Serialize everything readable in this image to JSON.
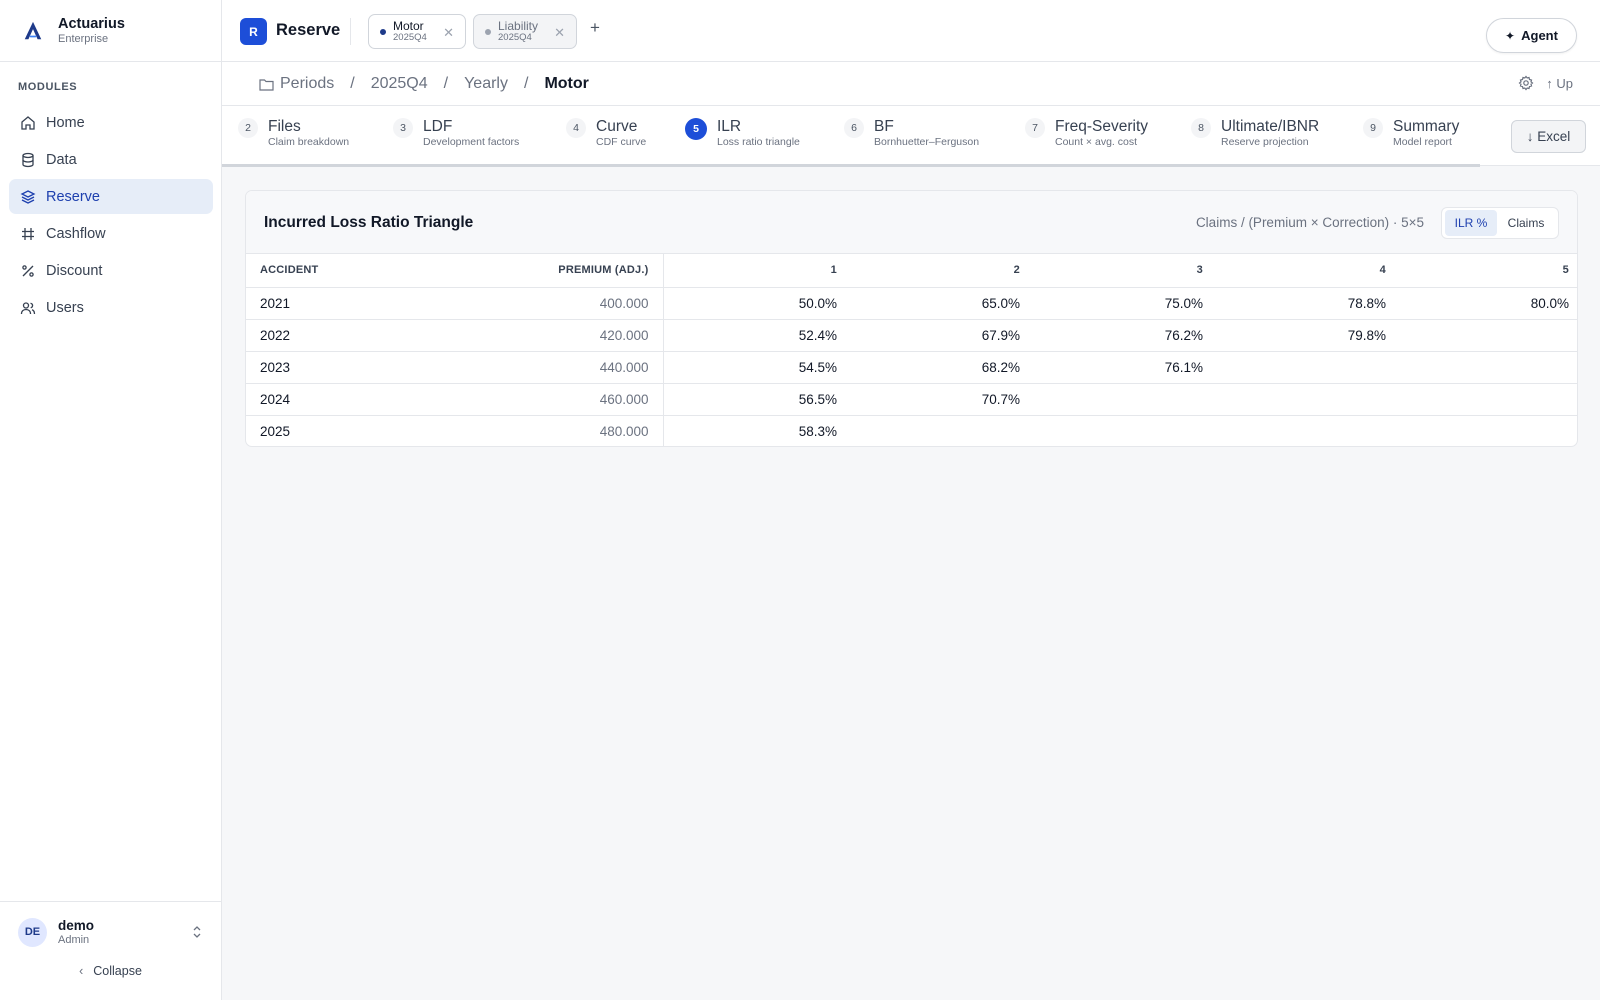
{
  "brand": {
    "name": "Actuarius",
    "edition": "Enterprise"
  },
  "sidebar": {
    "section_label": "MODULES",
    "items": [
      {
        "label": "Home",
        "icon": "home-icon",
        "active": false
      },
      {
        "label": "Data",
        "icon": "database-icon",
        "active": false
      },
      {
        "label": "Reserve",
        "icon": "layers-icon",
        "active": true
      },
      {
        "label": "Cashflow",
        "icon": "hash-icon",
        "active": false
      },
      {
        "label": "Discount",
        "icon": "percent-icon",
        "active": false
      },
      {
        "label": "Users",
        "icon": "users-icon",
        "active": false
      }
    ],
    "user": {
      "initials": "DE",
      "name": "demo",
      "role": "Admin"
    },
    "collapse_label": "Collapse"
  },
  "topbar": {
    "app_badge": "R",
    "app_title": "Reserve",
    "tabs": [
      {
        "name": "Motor",
        "period": "2025Q4",
        "active": true,
        "dot_color": "#1e3a8a"
      },
      {
        "name": "Liability",
        "period": "2025Q4",
        "active": false,
        "dot_color": "#9ca3af"
      }
    ],
    "add_tab": "+",
    "agent_label": "Agent"
  },
  "breadcrumb": {
    "items": [
      "Periods",
      "2025Q4",
      "Yearly",
      "Motor"
    ],
    "up_label": "Up"
  },
  "steps": [
    {
      "num": "2",
      "title": "Files",
      "subtitle": "Claim breakdown",
      "active": false
    },
    {
      "num": "3",
      "title": "LDF",
      "subtitle": "Development factors",
      "active": false
    },
    {
      "num": "4",
      "title": "Curve",
      "subtitle": "CDF curve",
      "active": false
    },
    {
      "num": "5",
      "title": "ILR",
      "subtitle": "Loss ratio triangle",
      "active": true
    },
    {
      "num": "6",
      "title": "BF",
      "subtitle": "Bornhuetter–Ferguson",
      "active": false
    },
    {
      "num": "7",
      "title": "Freq-Severity",
      "subtitle": "Count × avg. cost",
      "active": false
    },
    {
      "num": "8",
      "title": "Ultimate/IBNR",
      "subtitle": "Reserve projection",
      "active": false
    },
    {
      "num": "9",
      "title": "Summary",
      "subtitle": "Model report",
      "active": false
    }
  ],
  "excel_label": "Excel",
  "card": {
    "title": "Incurred Loss Ratio Triangle",
    "formula": "Claims / (Premium × Correction) · 5×5",
    "toggle": {
      "on": "ILR %",
      "off": "Claims"
    },
    "table": {
      "headers": [
        "ACCIDENT",
        "PREMIUM (ADJ.)",
        "1",
        "2",
        "3",
        "4",
        "5"
      ],
      "rows": [
        [
          "2021",
          "400.000",
          "50.0%",
          "65.0%",
          "75.0%",
          "78.8%",
          "80.0%"
        ],
        [
          "2022",
          "420.000",
          "52.4%",
          "67.9%",
          "76.2%",
          "79.8%",
          ""
        ],
        [
          "2023",
          "440.000",
          "54.5%",
          "68.2%",
          "76.1%",
          "",
          ""
        ],
        [
          "2024",
          "460.000",
          "56.5%",
          "70.7%",
          "",
          "",
          ""
        ],
        [
          "2025",
          "480.000",
          "58.3%",
          "",
          "",
          "",
          ""
        ]
      ]
    }
  }
}
